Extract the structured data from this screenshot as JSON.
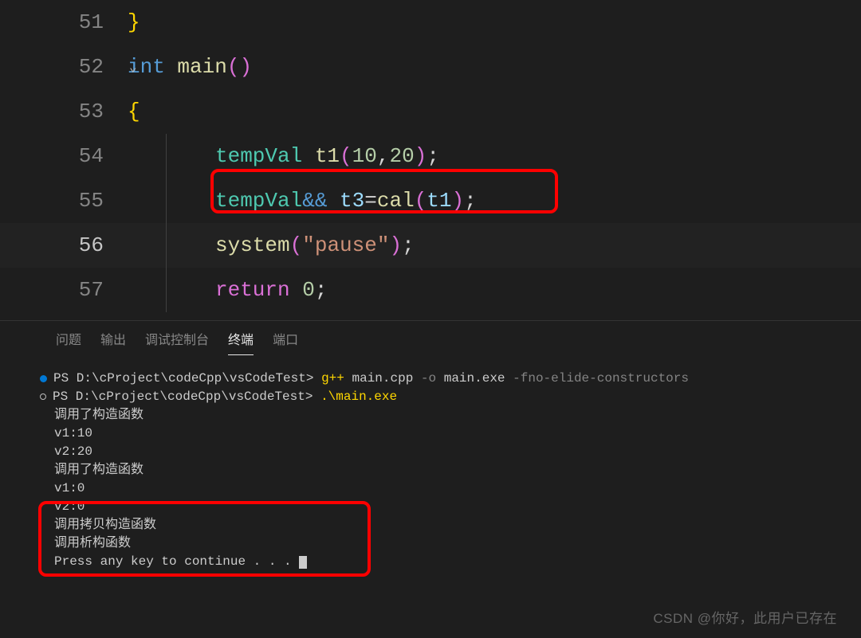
{
  "editor": {
    "lines": {
      "n51": "51",
      "n52": "52",
      "n53": "53",
      "n54": "54",
      "n55": "55",
      "n56": "56",
      "n57": "57"
    },
    "l51_brace": "}",
    "l52_int": "int",
    "l52_main": "main",
    "l52_lp": "(",
    "l52_rp": ")",
    "l53_brace": "{",
    "l54_type": "tempVal",
    "l54_sp": " ",
    "l54_var": "t1",
    "l54_lp": "(",
    "l54_n1": "10",
    "l54_comma": ",",
    "l54_n2": "20",
    "l54_rp": ")",
    "l54_semi": ";",
    "l55_type": "tempVal",
    "l55_amp": "&&",
    "l55_sp": " ",
    "l55_var": "t3",
    "l55_eq": "=",
    "l55_cal": "cal",
    "l55_lp": "(",
    "l55_arg": "t1",
    "l55_rp": ")",
    "l55_semi": ";",
    "l56_sys": "system",
    "l56_lp": "(",
    "l56_str": "\"pause\"",
    "l56_rp": ")",
    "l56_semi": ";",
    "l57_ret": "return",
    "l57_sp": " ",
    "l57_n": "0",
    "l57_semi": ";"
  },
  "panel": {
    "tabs": {
      "problems": "问题",
      "output": "输出",
      "debug": "调试控制台",
      "terminal": "终端",
      "ports": "端口"
    }
  },
  "term": {
    "ps": "PS D:\\cProject\\codeCpp\\vsCodeTest> ",
    "cmd1_exe": "g++",
    "cmd1_arg1": " main.cpp",
    "cmd1_flag1": " -o",
    "cmd1_arg2": " main.exe",
    "cmd1_flag2": " -fno-elide-constructors",
    "cmd2_exe": ".\\main.exe",
    "out1": "调用了构造函数",
    "out2": "v1:10",
    "out3": "v2:20",
    "out4": "调用了构造函数",
    "out5": "v1:0",
    "out6": "v2:0",
    "out7": "调用拷贝构造函数",
    "out8": "调用析构函数",
    "out9": "Press any key to continue . . . "
  },
  "watermark": "CSDN @你好，此用户已存在"
}
